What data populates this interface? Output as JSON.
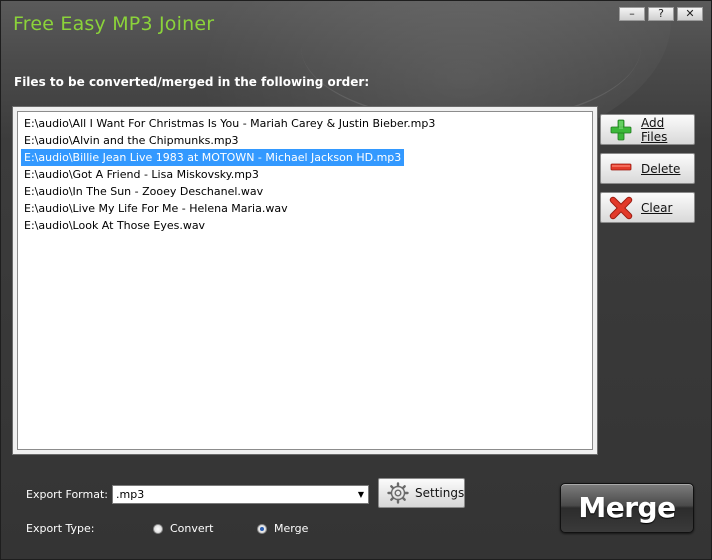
{
  "app": {
    "title": "Free Easy MP3 Joiner"
  },
  "window_controls": {
    "minimize": "–",
    "help": "?",
    "close": "✕"
  },
  "main": {
    "subtitle": "Files to be converted/merged in the following order:",
    "files": [
      "E:\\audio\\All I Want For Christmas Is You - Mariah Carey & Justin Bieber.mp3",
      "E:\\audio\\Alvin and the Chipmunks.mp3",
      "E:\\audio\\Billie Jean Live 1983 at MOTOWN - Michael Jackson HD.mp3",
      "E:\\audio\\Got A Friend - Lisa Miskovsky.mp3",
      "E:\\audio\\In The Sun - Zooey Deschanel.wav",
      "E:\\audio\\Live My Life For Me - Helena Maria.wav",
      "E:\\audio\\Look At Those Eyes.wav"
    ],
    "selected_index": 2
  },
  "side_buttons": {
    "add_files": {
      "label": "Add Files",
      "icon": "plus-icon",
      "color": "#3cb83a"
    },
    "delete": {
      "label": "Delete",
      "icon": "minus-icon",
      "color": "#e23a2a"
    },
    "clear": {
      "label": "Clear",
      "icon": "x-icon",
      "color": "#e23a2a"
    }
  },
  "export": {
    "format_label": "Export Format:",
    "format_value": ".mp3",
    "settings_label": "Settings",
    "type_label": "Export Type:",
    "type_options": [
      "Convert",
      "Merge"
    ],
    "type_selected": "Merge"
  },
  "merge_button": {
    "label": "Merge"
  },
  "colors": {
    "accent": "#8bd33a",
    "selection": "#3399ff"
  }
}
